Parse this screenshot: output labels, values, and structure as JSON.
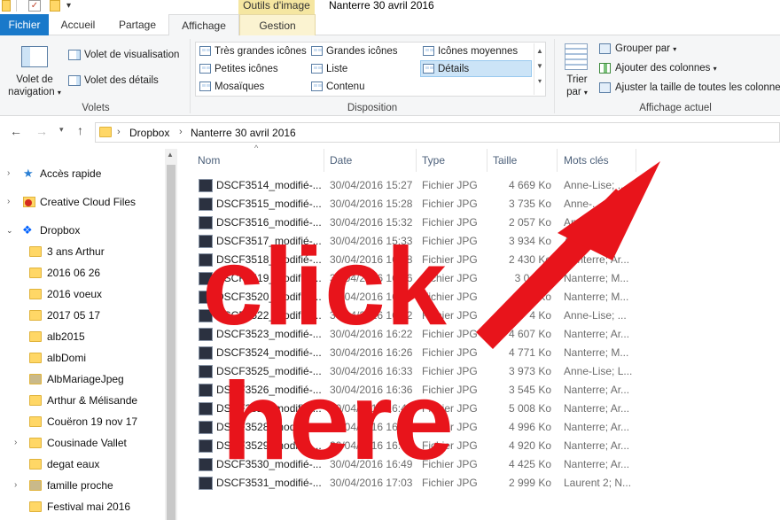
{
  "window": {
    "title": "Nanterre 30 avril 2016",
    "context_tab_label": "Outils d'image"
  },
  "tabs": [
    {
      "label": "Fichier"
    },
    {
      "label": "Accueil"
    },
    {
      "label": "Partage"
    },
    {
      "label": "Affichage"
    },
    {
      "label": "Gestion"
    }
  ],
  "ribbon": {
    "volets": {
      "navigation_label_1": "Volet de",
      "navigation_label_2": "navigation",
      "preview_label": "Volet de visualisation",
      "details_label": "Volet des détails",
      "group_label": "Volets"
    },
    "disposition": {
      "items": [
        {
          "label": "Très grandes icônes"
        },
        {
          "label": "Grandes icônes"
        },
        {
          "label": "Icônes moyennes"
        },
        {
          "label": "Petites icônes"
        },
        {
          "label": "Liste"
        },
        {
          "label": "Détails"
        },
        {
          "label": "Mosaïques"
        },
        {
          "label": "Contenu"
        }
      ],
      "group_label": "Disposition"
    },
    "affichage_actuel": {
      "sort_label_1": "Trier",
      "sort_label_2": "par",
      "group_by_label": "Grouper par",
      "add_columns_label": "Ajouter des colonnes",
      "fit_columns_label": "Ajuster la taille de toutes les colonnes",
      "group_label": "Affichage actuel"
    }
  },
  "address": {
    "crumbs": [
      "Dropbox",
      "Nanterre 30 avril 2016"
    ]
  },
  "nav": {
    "items": [
      {
        "label": "Accès rapide"
      },
      {
        "label": "Creative Cloud Files"
      },
      {
        "label": "Dropbox"
      },
      {
        "label": "3 ans Arthur"
      },
      {
        "label": "2016 06 26"
      },
      {
        "label": "2016 voeux"
      },
      {
        "label": "2017 05 17"
      },
      {
        "label": "alb2015"
      },
      {
        "label": "albDomi"
      },
      {
        "label": "AlbMariageJpeg"
      },
      {
        "label": "Arthur & Mélisande"
      },
      {
        "label": "Couëron 19 nov 17"
      },
      {
        "label": "Cousinade Vallet"
      },
      {
        "label": "degat eaux"
      },
      {
        "label": "famille proche"
      },
      {
        "label": "Festival mai 2016"
      }
    ]
  },
  "columns": [
    "Nom",
    "Date",
    "Type",
    "Taille",
    "Mots clés"
  ],
  "files": [
    {
      "name": "DSCF3514_modifié-...",
      "date": "30/04/2016 15:27",
      "type": "Fichier JPG",
      "size": "4 669 Ko",
      "tags": "Anne-Lise; ..."
    },
    {
      "name": "DSCF3515_modifié-...",
      "date": "30/04/2016 15:28",
      "type": "Fichier JPG",
      "size": "3 735 Ko",
      "tags": "Anne-..."
    },
    {
      "name": "DSCF3516_modifié-...",
      "date": "30/04/2016 15:32",
      "type": "Fichier JPG",
      "size": "2 057 Ko",
      "tags": "Anne-..."
    },
    {
      "name": "DSCF3517_modifié-...",
      "date": "30/04/2016 15:33",
      "type": "Fichier JPG",
      "size": "3 934 Ko",
      "tags": "Anne-L..."
    },
    {
      "name": "DSCF3518_modifié-...",
      "date": "30/04/2016 16:08",
      "type": "Fichier JPG",
      "size": "2 430 Ko",
      "tags": "Nanterre; Ar..."
    },
    {
      "name": "DSCF3519_modifié-...",
      "date": "30/04/2016 16:16",
      "type": "Fichier JPG",
      "size": "3 0.. Ko",
      "tags": "Nanterre; M..."
    },
    {
      "name": "DSCF3520_modifié-...",
      "date": "30/04/2016 16:18",
      "type": "Fichier JPG",
      "size": "3 . Ko",
      "tags": "Nanterre; M..."
    },
    {
      "name": "DSCF3522_modifié-...",
      "date": "30/04/2016 16:22",
      "type": "Fichier JPG",
      "size": "4 Ko",
      "tags": "Anne-Lise; ..."
    },
    {
      "name": "DSCF3523_modifié-...",
      "date": "30/04/2016 16:22",
      "type": "Fichier JPG",
      "size": "4 607 Ko",
      "tags": "Nanterre; Ar..."
    },
    {
      "name": "DSCF3524_modifié-...",
      "date": "30/04/2016 16:26",
      "type": "Fichier JPG",
      "size": "4 771 Ko",
      "tags": "Nanterre; M..."
    },
    {
      "name": "DSCF3525_modifié-...",
      "date": "30/04/2016 16:33",
      "type": "Fichier JPG",
      "size": "3 973 Ko",
      "tags": "Anne-Lise; L..."
    },
    {
      "name": "DSCF3526_modifié-...",
      "date": "30/04/2016 16:36",
      "type": "Fichier JPG",
      "size": "3 545 Ko",
      "tags": "Nanterre; Ar..."
    },
    {
      "name": "DSCF3527_modifié-...",
      "date": "30/04/2016 16:44",
      "type": "Fichier JPG",
      "size": "5 008 Ko",
      "tags": "Nanterre; Ar..."
    },
    {
      "name": "DSCF3528_modifié-...",
      "date": "30/04/2016 16:45",
      "type": "Fichier JPG",
      "size": "4 996 Ko",
      "tags": "Nanterre; Ar..."
    },
    {
      "name": "DSCF3529_modifié-...",
      "date": "30/04/2016 16:46",
      "type": "Fichier JPG",
      "size": "4 920 Ko",
      "tags": "Nanterre; Ar..."
    },
    {
      "name": "DSCF3530_modifié-...",
      "date": "30/04/2016 16:49",
      "type": "Fichier JPG",
      "size": "4 425 Ko",
      "tags": "Nanterre; Ar..."
    },
    {
      "name": "DSCF3531_modifié-...",
      "date": "30/04/2016 17:03",
      "type": "Fichier JPG",
      "size": "2 999 Ko",
      "tags": "Laurent 2; N..."
    }
  ],
  "overlay": {
    "line1": "click",
    "line2": "here",
    "color": "#e8141b"
  }
}
